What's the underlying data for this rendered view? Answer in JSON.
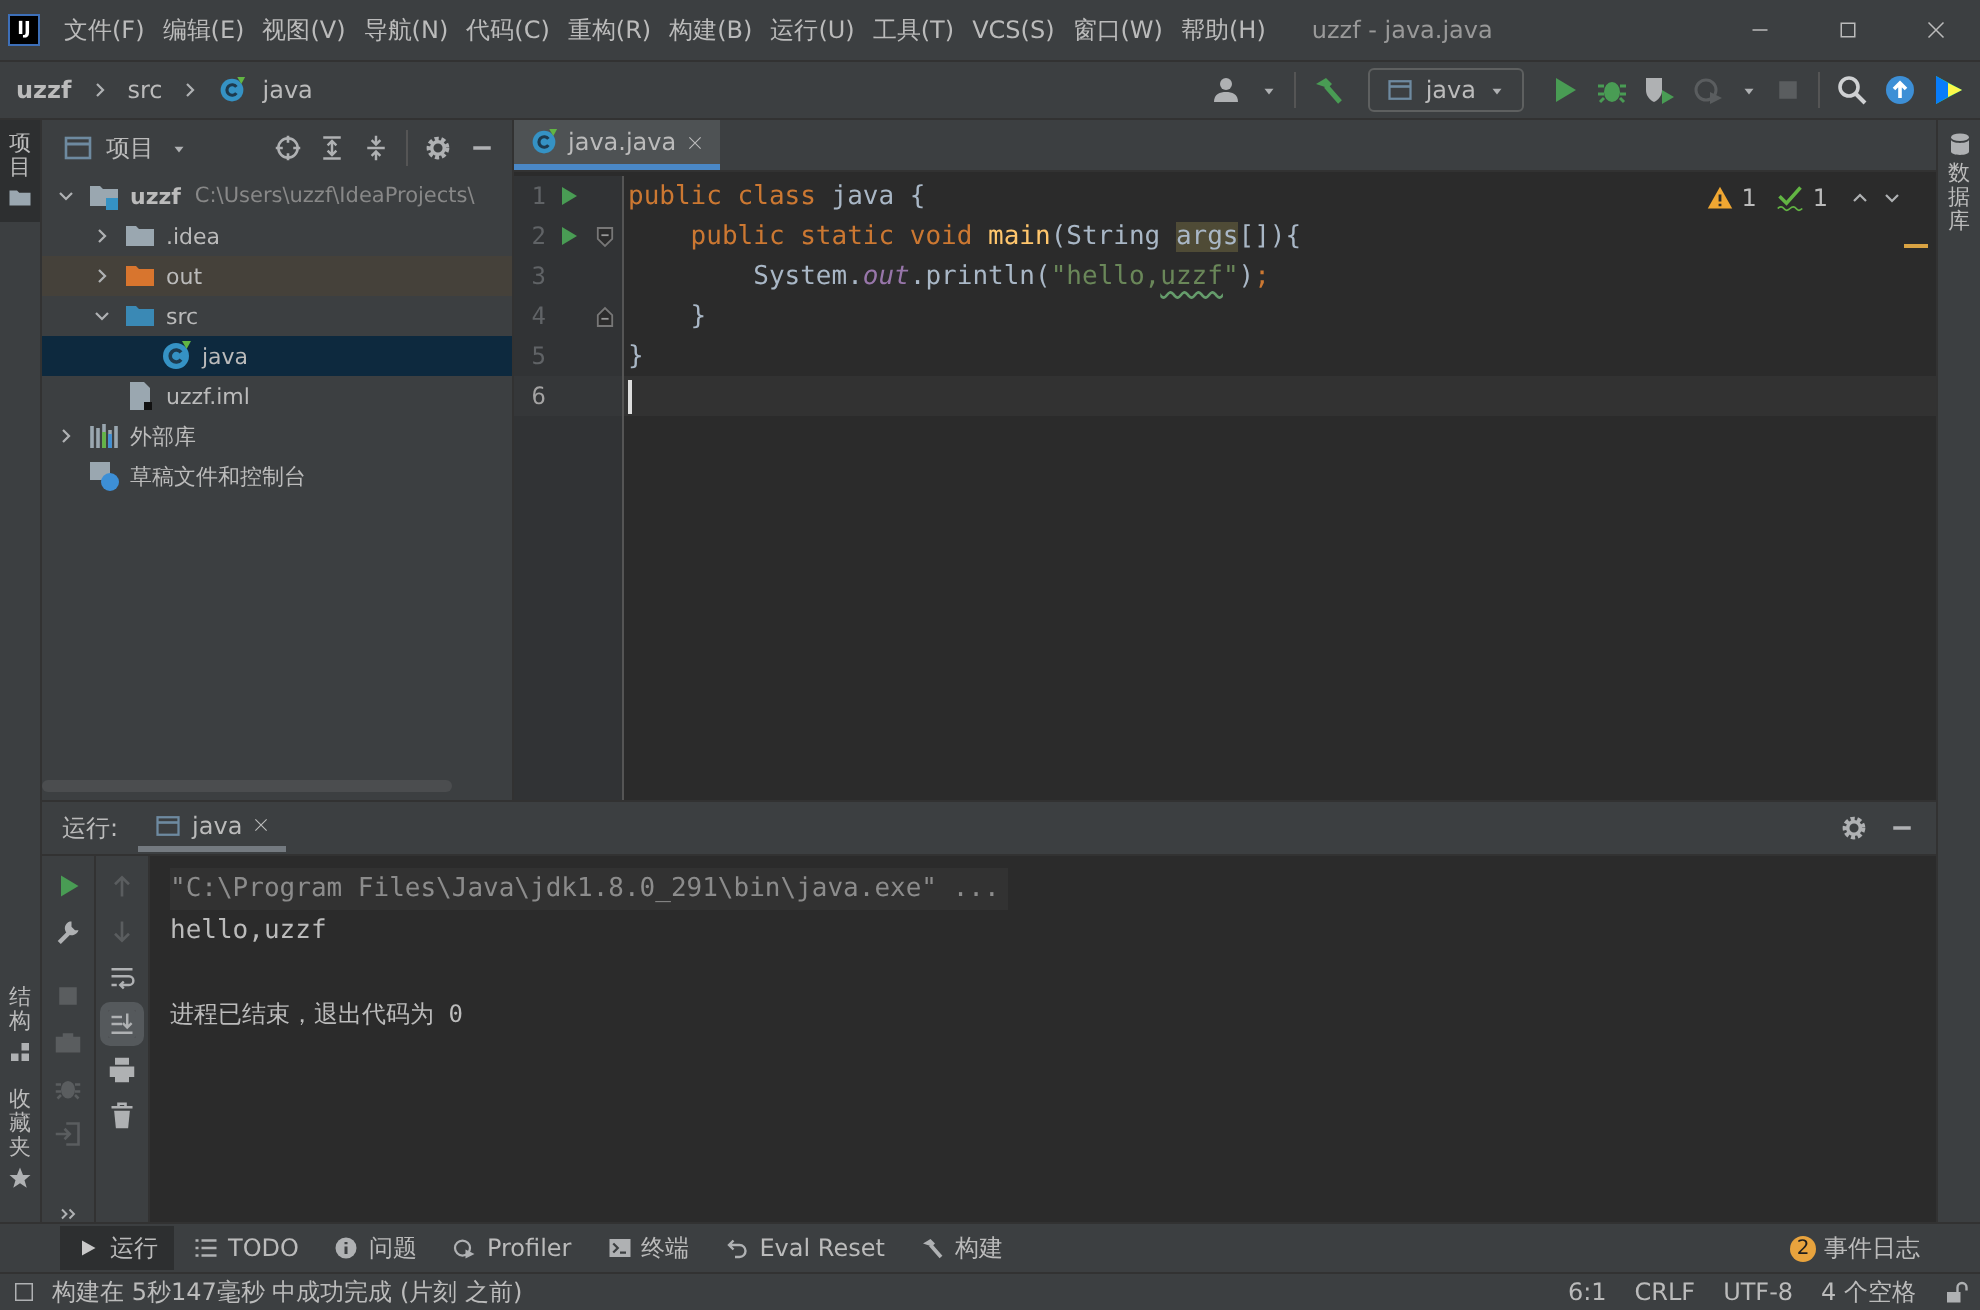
{
  "title_bar": {
    "logo": "IJ",
    "menus": [
      "文件(F)",
      "编辑(E)",
      "视图(V)",
      "导航(N)",
      "代码(C)",
      "重构(R)",
      "构建(B)",
      "运行(U)",
      "工具(T)",
      "VCS(S)",
      "窗口(W)",
      "帮助(H)"
    ],
    "title": "uzzf - java.java"
  },
  "nav_bar": {
    "breadcrumbs": [
      "uzzf",
      "src",
      "java"
    ],
    "run_config": "java",
    "stop_enabled": false
  },
  "left_strip": {
    "top": [
      {
        "label": "项目",
        "selected": true
      }
    ],
    "bottom": [
      {
        "label": "结构",
        "selected": false
      },
      {
        "label": "收藏夹",
        "selected": false
      }
    ]
  },
  "project": {
    "title": "项目",
    "tree": [
      {
        "label": "uzzf",
        "detail": "C:\\Users\\uzzf\\IdeaProjects\\",
        "kind": "module",
        "expanded": true,
        "selected": false,
        "children": [
          {
            "label": ".idea",
            "kind": "folder",
            "expanded": false,
            "selected": false
          },
          {
            "label": "out",
            "kind": "excluded",
            "expanded": false,
            "selected": false
          },
          {
            "label": "src",
            "kind": "source",
            "expanded": true,
            "selected": false,
            "children": [
              {
                "label": "java",
                "kind": "class",
                "selected": true
              }
            ]
          },
          {
            "label": "uzzf.iml",
            "kind": "file",
            "selected": false
          }
        ]
      },
      {
        "label": "外部库",
        "kind": "library",
        "expanded": false,
        "selected": false
      },
      {
        "label": "草稿文件和控制台",
        "kind": "scratch",
        "selected": false
      }
    ]
  },
  "editor": {
    "tabs": [
      {
        "label": "java.java",
        "selected": true
      }
    ],
    "inspections": {
      "warnings": "1",
      "typos": "1"
    },
    "lines": [
      {
        "number": "1",
        "run": true,
        "fold_start": false,
        "fold_end": false,
        "current": false,
        "tokens": [
          {
            "kind": "keyword",
            "text": "public class "
          },
          {
            "kind": "plain",
            "text": "java {"
          }
        ]
      },
      {
        "number": "2",
        "run": true,
        "fold_start": true,
        "fold_end": false,
        "current": false,
        "tokens": [
          {
            "kind": "keyword",
            "text": "    public static void "
          },
          {
            "kind": "method",
            "text": "main"
          },
          {
            "kind": "plain",
            "text": "(String "
          },
          {
            "kind": "highlight",
            "text": "args"
          },
          {
            "kind": "plain",
            "text": "[]){"
          }
        ]
      },
      {
        "number": "3",
        "run": false,
        "fold_start": false,
        "fold_end": false,
        "current": false,
        "tokens": [
          {
            "kind": "plain",
            "text": "        System."
          },
          {
            "kind": "field",
            "text": "out"
          },
          {
            "kind": "plain",
            "text": ".println("
          },
          {
            "kind": "string",
            "text": "\"hello,"
          },
          {
            "kind": "typo",
            "text": "uzzf"
          },
          {
            "kind": "string",
            "text": "\""
          },
          {
            "kind": "plain",
            "text": ")"
          },
          {
            "kind": "keyword",
            "text": ";"
          }
        ]
      },
      {
        "number": "4",
        "run": false,
        "fold_start": false,
        "fold_end": true,
        "current": false,
        "tokens": [
          {
            "kind": "plain",
            "text": "    }"
          }
        ]
      },
      {
        "number": "5",
        "run": false,
        "fold_start": false,
        "fold_end": false,
        "current": false,
        "tokens": [
          {
            "kind": "plain",
            "text": "}"
          }
        ]
      },
      {
        "number": "6",
        "run": false,
        "fold_start": false,
        "fold_end": false,
        "current": true,
        "caret": true
      }
    ]
  },
  "right_strip": [
    {
      "label": "数据库",
      "selected": false
    }
  ],
  "run": {
    "label": "运行:",
    "tabs": [
      {
        "label": "java",
        "selected": true
      }
    ],
    "stop_enabled": false,
    "scroll_to_end": true,
    "console": [
      {
        "kind": "command",
        "text": "\"C:\\Program Files\\Java\\jdk1.8.0_291\\bin\\java.exe\" ..."
      },
      {
        "kind": "output",
        "text": "hello,uzzf"
      },
      {
        "kind": "exit",
        "text": "进程已结束，退出代码为 0"
      }
    ]
  },
  "tool_tabs": [
    {
      "kind": "run",
      "label": "运行",
      "selected": true
    },
    {
      "kind": "todo",
      "label": "TODO",
      "selected": false
    },
    {
      "kind": "problems",
      "label": "问题",
      "selected": false
    },
    {
      "kind": "profiler",
      "label": "Profiler",
      "selected": false
    },
    {
      "kind": "terminal",
      "label": "终端",
      "selected": false
    },
    {
      "kind": "reset",
      "label": "Eval Reset",
      "selected": false
    },
    {
      "kind": "build",
      "label": "构建",
      "selected": false
    }
  ],
  "event_log": {
    "count": "2",
    "label": "事件日志"
  },
  "status_bar": {
    "message": "构建在 5秒147毫秒 中成功完成 (片刻 之前)",
    "position": "6:1",
    "line_separator": "CRLF",
    "encoding": "UTF-8",
    "indent": "4 个空格"
  }
}
